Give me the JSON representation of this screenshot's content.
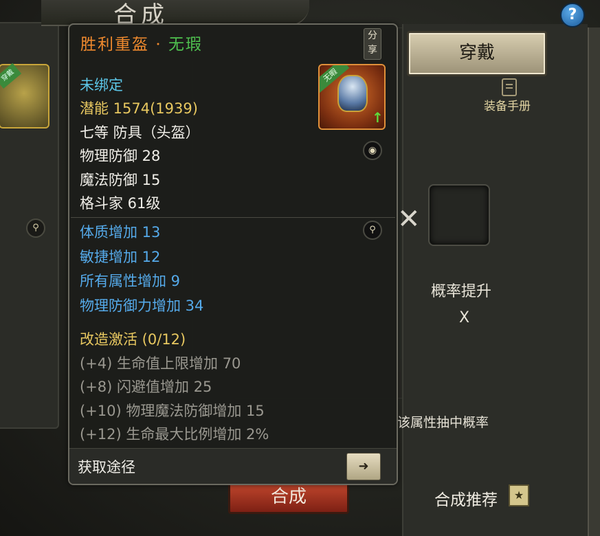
{
  "header": {
    "title": "合成",
    "help_icon": "question-mark-icon"
  },
  "right_panel": {
    "wear_button": "穿戴",
    "manual_label": "装备手册",
    "cross_symbol": "✕",
    "prob_label": "概率提升",
    "prob_value": "X",
    "hint_tail": "该属性抽中概率",
    "synth_button": "合成",
    "recommend_label": "合成推荐"
  },
  "left_panel": {
    "item_tag": "穿戴"
  },
  "tooltip": {
    "name": "胜利重盔",
    "separator": "·",
    "quality": "无瑕",
    "share_button": "分享",
    "item_tag": "无暇",
    "lines": {
      "bind": "未绑定",
      "potential": "潜能 1574(1939)",
      "grade": "七等 防具（头盔）",
      "phys_def": "物理防御 28",
      "magic_def": "魔法防御 15",
      "req": "格斗家 61级",
      "attr1": "体质增加 13",
      "attr2": "敏捷增加 12",
      "attr3": "所有属性增加 9",
      "attr4": "物理防御力增加 34",
      "reforge": "改造激活 (0/12)",
      "ref1": "(+4)  生命值上限增加 70",
      "ref2": "(+8)  闪避值增加 25",
      "ref3": "(+10) 物理魔法防御增加 15",
      "ref4": "(+12) 生命最大比例增加 2%"
    },
    "footer_label": "获取途径"
  }
}
